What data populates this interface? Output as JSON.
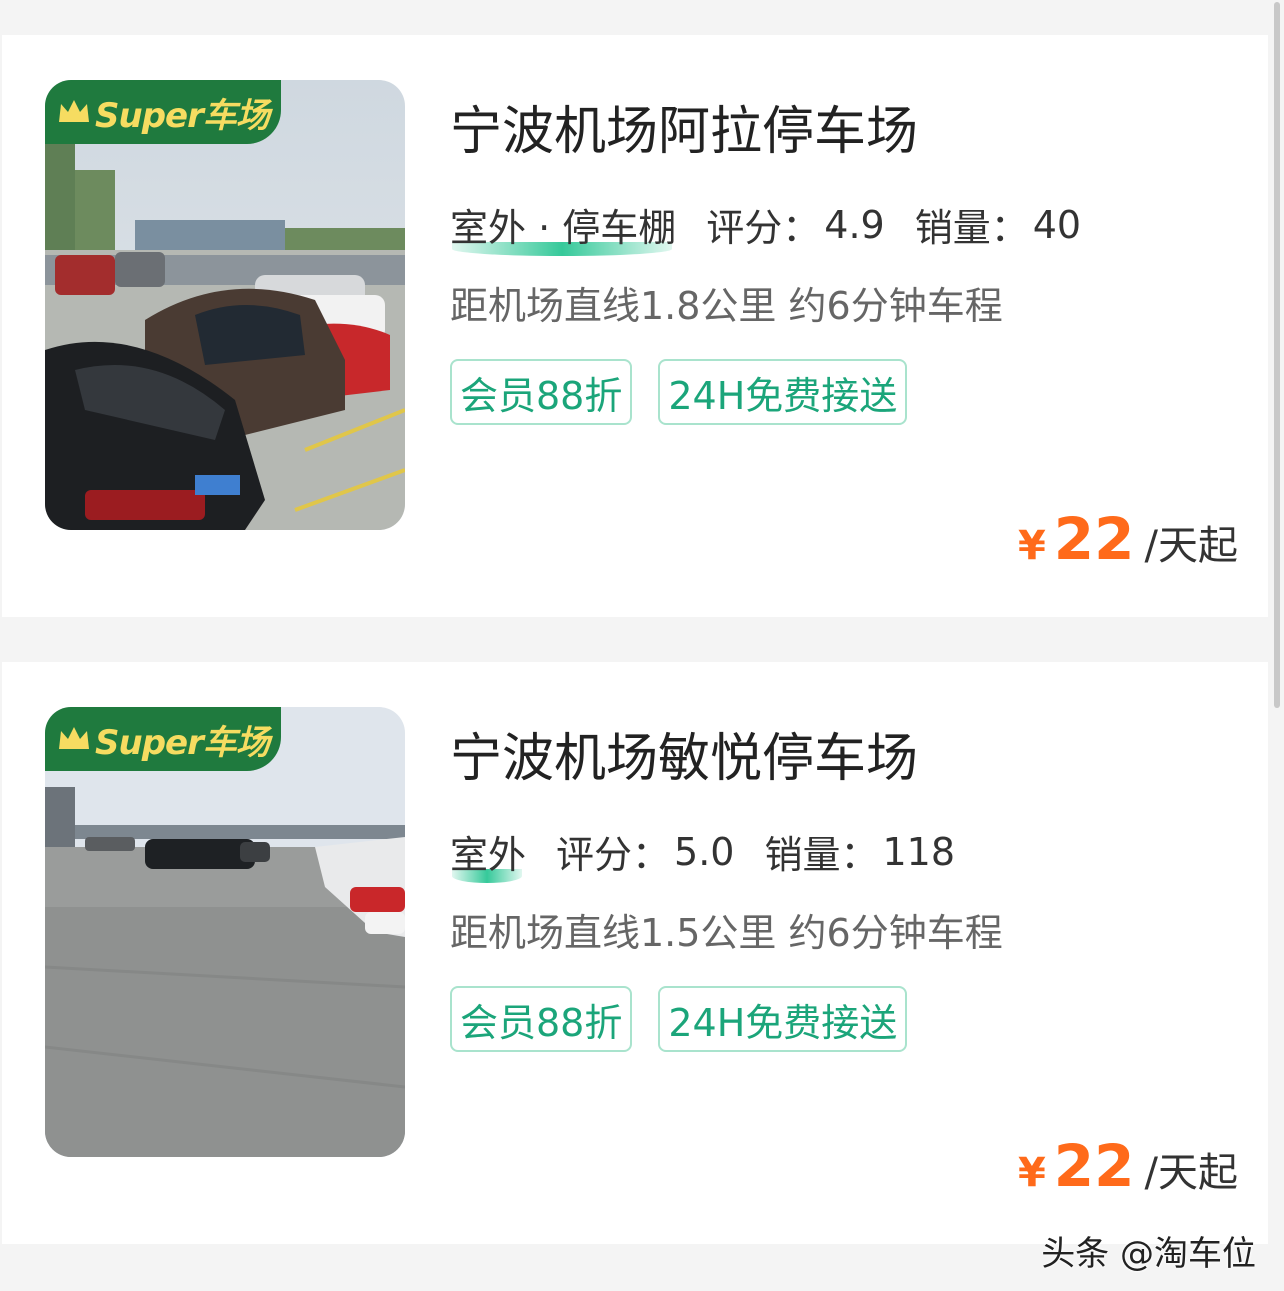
{
  "listings": [
    {
      "badge": "Super车场",
      "title": "宁波机场阿拉停车场",
      "feature": "室外 · 停车棚",
      "rating_label": "评分：",
      "rating": "4.9",
      "sales_label": "销量：",
      "sales": "40",
      "distance": "距机场直线1.8公里 约6分钟车程",
      "tags": [
        "会员88折",
        "24H免费接送"
      ],
      "currency": "¥",
      "price": "22",
      "unit": "/天起"
    },
    {
      "badge": "Super车场",
      "title": "宁波机场敏悦停车场",
      "feature": "室外",
      "rating_label": "评分：",
      "rating": "5.0",
      "sales_label": "销量：",
      "sales": "118",
      "distance": "距机场直线1.5公里 约6分钟车程",
      "tags": [
        "会员88折",
        "24H免费接送"
      ],
      "currency": "¥",
      "price": "22",
      "unit": "/天起"
    }
  ],
  "watermark": "头条 @淘车位",
  "colors": {
    "accent_green": "#1ba57a",
    "badge_green": "#1f7a3e",
    "badge_text": "#f6dc61",
    "price_orange": "#ff6a1a"
  }
}
